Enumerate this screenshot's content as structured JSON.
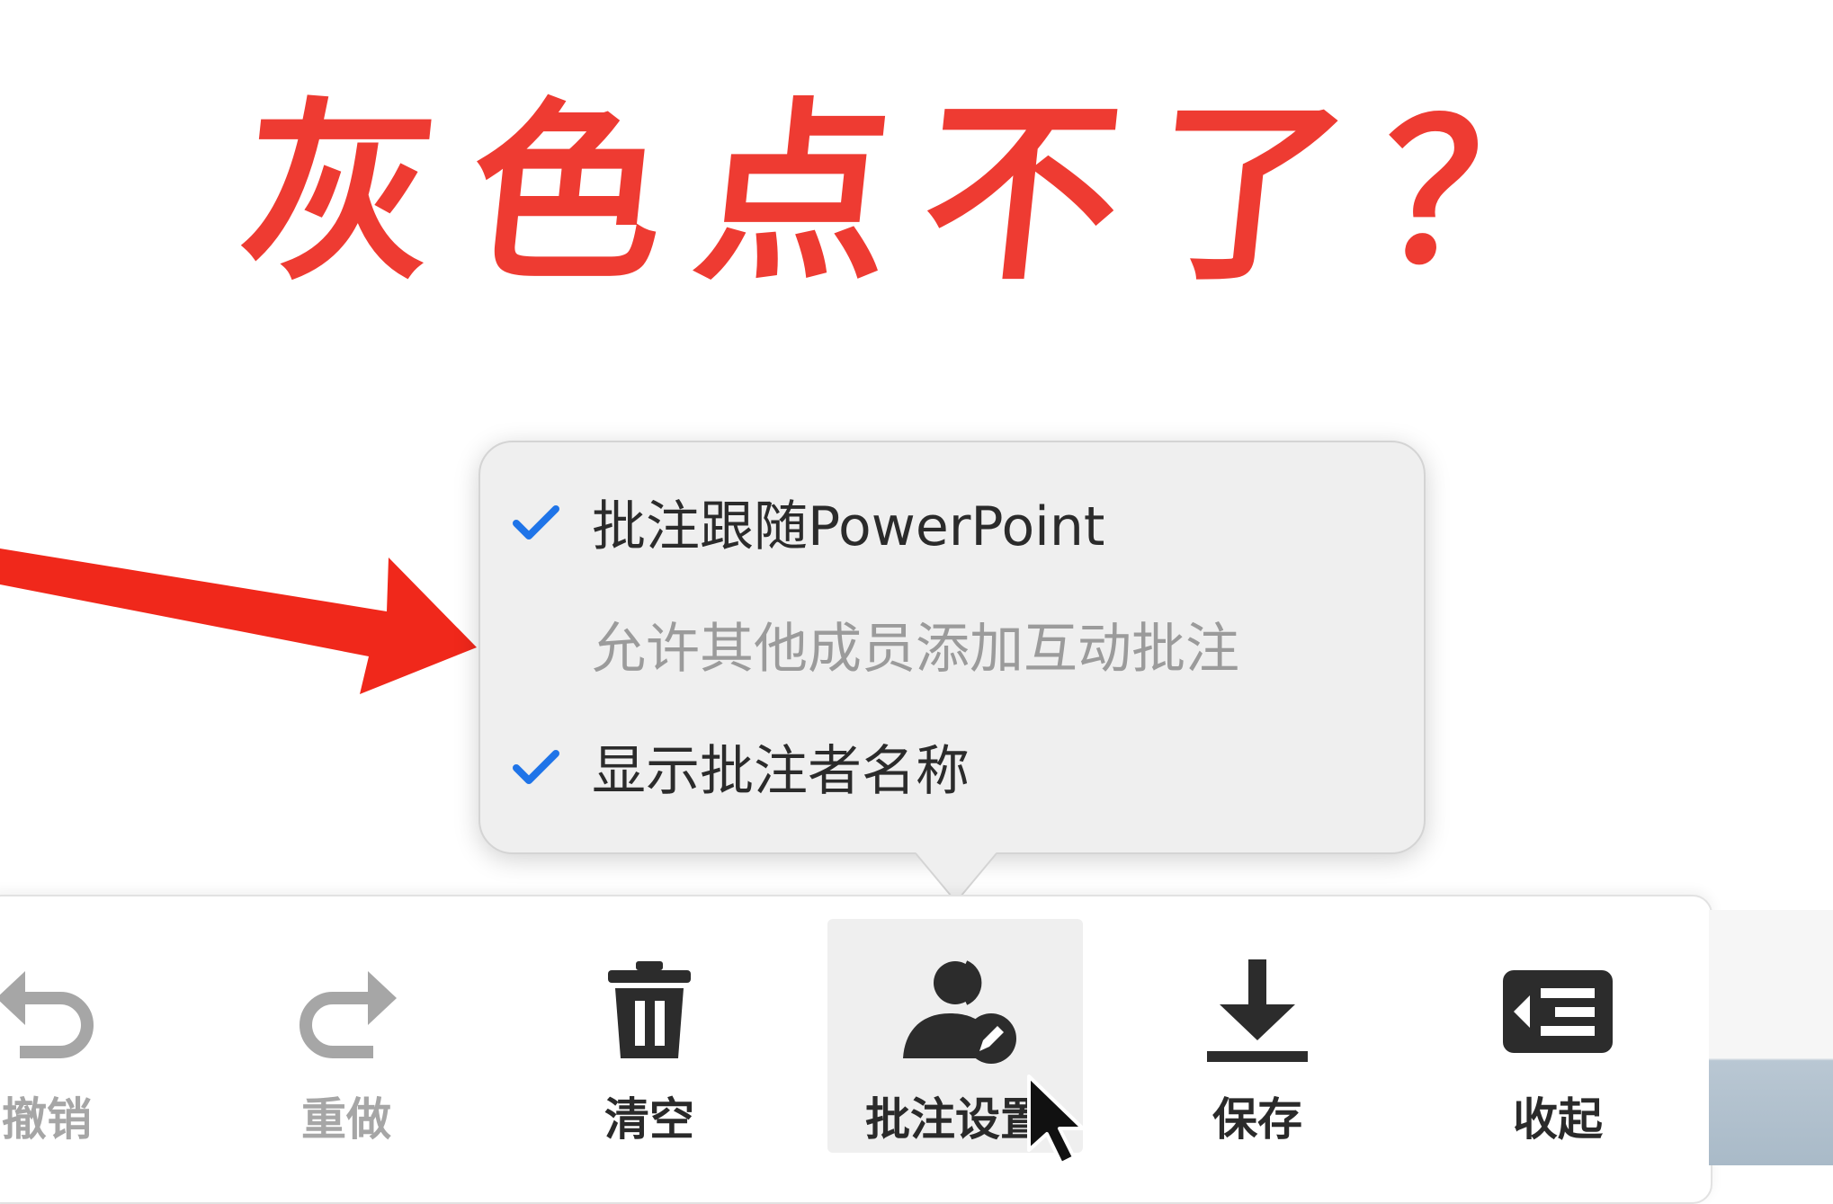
{
  "caption": "灰色点不了？",
  "popover": {
    "items": [
      {
        "label": "批注跟随PowerPoint",
        "checked": true,
        "enabled": true
      },
      {
        "label": "允许其他成员添加互动批注",
        "checked": false,
        "enabled": false
      },
      {
        "label": "显示批注者名称",
        "checked": true,
        "enabled": true
      }
    ]
  },
  "toolbar": {
    "undo_label": "撤销",
    "redo_label": "重做",
    "clear_label": "清空",
    "annotation_settings_label": "批注设置",
    "save_label": "保存",
    "collapse_label": "收起"
  },
  "colors": {
    "caption": "#ee3b32",
    "arrow": "#f0281b",
    "check": "#1f74e8",
    "icon_dark": "#2c2c2c",
    "icon_disabled": "#a6a6a6"
  }
}
